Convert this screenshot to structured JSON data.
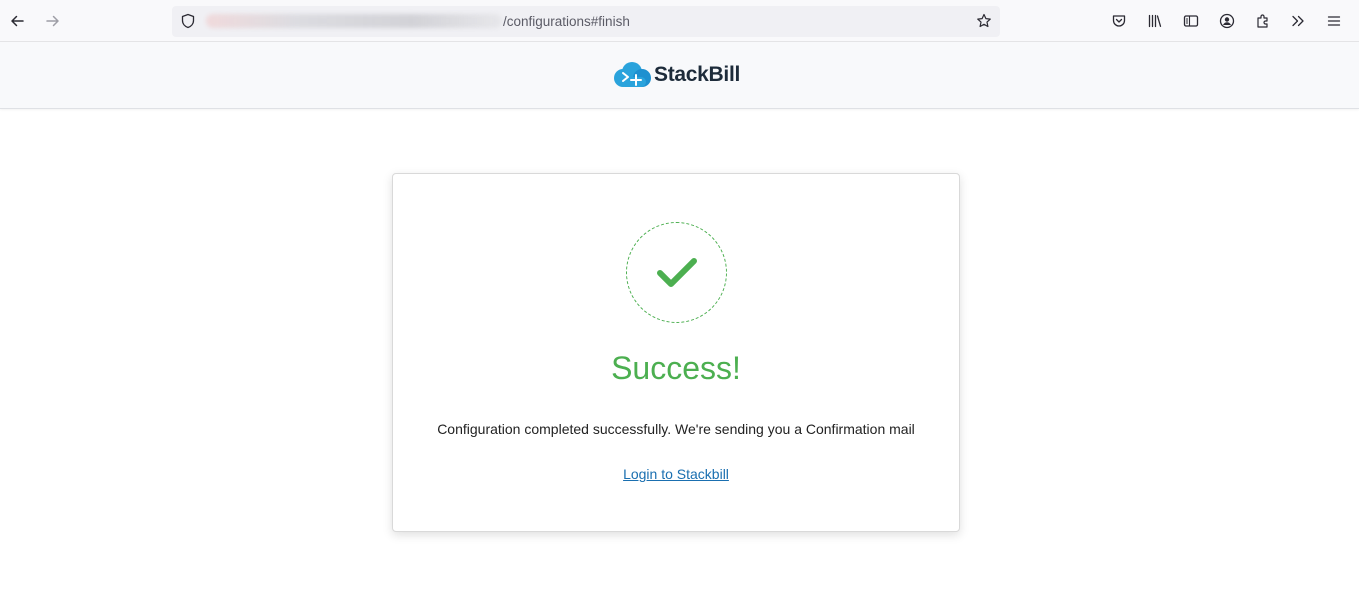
{
  "browser": {
    "url_path": "/configurations#finish",
    "back_icon": "back-arrow-icon",
    "forward_icon": "forward-arrow-icon",
    "shield_icon": "shield-icon",
    "bookmark_icon": "star-icon",
    "toolbar_icons": [
      "pocket-icon",
      "library-icon",
      "sidebar-icon",
      "account-icon",
      "extensions-icon",
      "overflow-icon",
      "menu-icon"
    ]
  },
  "header": {
    "logo_text": "StackBill",
    "logo_icon": "cloud-logo-icon"
  },
  "card": {
    "icon": "checkmark-icon",
    "title": "Success!",
    "message": "Configuration completed successfully. We're sending you a Confirmation mail",
    "link_label": "Login to Stackbill"
  },
  "colors": {
    "success": "#4caf50",
    "link": "#1a6fb0",
    "logo_blue": "#2aa3dc"
  }
}
